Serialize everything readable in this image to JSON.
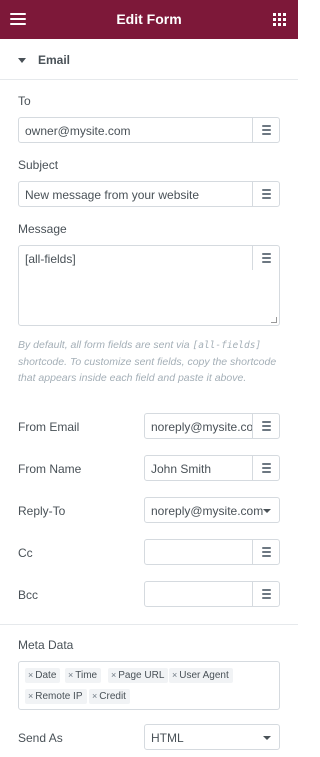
{
  "header": {
    "title": "Edit Form",
    "menu_icon": "hamburger-icon",
    "apps_icon": "grid-icon"
  },
  "colors": {
    "header_bg": "#7d1839"
  },
  "section": {
    "title": "Email"
  },
  "fields": {
    "to": {
      "label": "To",
      "value": "owner@mysite.com"
    },
    "subject": {
      "label": "Subject",
      "value": "New message from your website"
    },
    "message": {
      "label": "Message",
      "value": "[all-fields]"
    },
    "description": {
      "part1": "By default, all form fields are sent via ",
      "code": "[all-fields]",
      "part2": " shortcode. To customize sent fields, copy the shortcode that appears inside each field and paste it above."
    },
    "from_email": {
      "label": "From Email",
      "value": "noreply@mysite.com"
    },
    "from_name": {
      "label": "From Name",
      "value": "John Smith"
    },
    "reply_to": {
      "label": "Reply-To",
      "value": "noreply@mysite.com"
    },
    "cc": {
      "label": "Cc",
      "value": ""
    },
    "bcc": {
      "label": "Bcc",
      "value": ""
    }
  },
  "meta_data": {
    "label": "Meta Data",
    "tags": [
      "Date",
      "Time",
      "Page URL",
      "User Agent",
      "Remote IP",
      "Credit"
    ],
    "remove_glyph": "×"
  },
  "send_as": {
    "label": "Send As",
    "value": "HTML"
  }
}
